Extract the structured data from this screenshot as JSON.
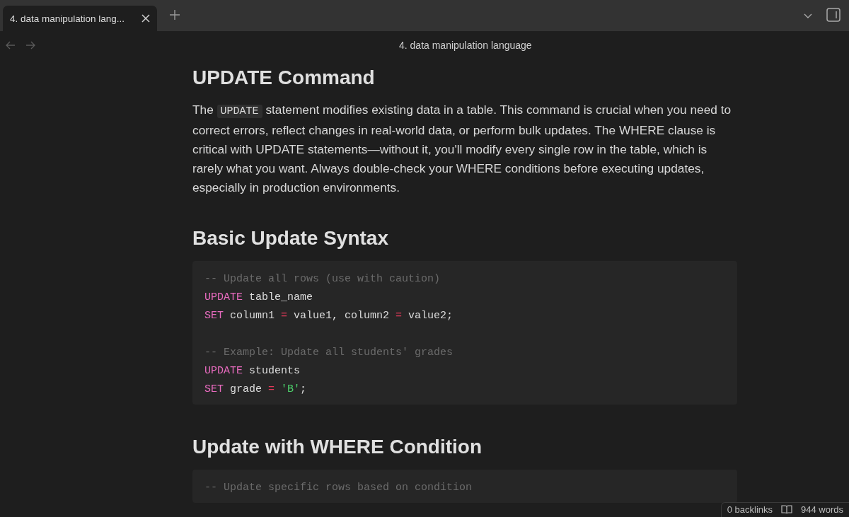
{
  "tabs": [
    {
      "label": "4. data manipulation lang...",
      "selected": true
    }
  ],
  "note_title": "4. data manipulation language",
  "sections": [
    {
      "heading": "UPDATE Command",
      "paragraph": {
        "before": "The ",
        "code": "UPDATE",
        "after": " statement modifies existing data in a table. This command is crucial when you need to correct errors, reflect changes in real-world data, or perform bulk updates. The WHERE clause is critical with UPDATE statements—without it, you'll modify every single row in the table, which is rarely what you want. Always double-check your WHERE conditions before executing updates, especially in production environments."
      }
    },
    {
      "heading": "Basic Update Syntax",
      "code_lines": [
        {
          "kind": "code",
          "tokens": [
            {
              "kind": "comment",
              "text": "-- Update all rows (use with caution)"
            }
          ]
        },
        {
          "kind": "code",
          "tokens": [
            {
              "kind": "keyword",
              "text": "UPDATE"
            },
            {
              "kind": "plain",
              "text": " table_name"
            }
          ]
        },
        {
          "kind": "code",
          "tokens": [
            {
              "kind": "keyword",
              "text": "SET"
            },
            {
              "kind": "plain",
              "text": " column1 "
            },
            {
              "kind": "operator",
              "text": "="
            },
            {
              "kind": "plain",
              "text": " value1, column2 "
            },
            {
              "kind": "operator",
              "text": "="
            },
            {
              "kind": "plain",
              "text": " value2;"
            }
          ]
        },
        {
          "kind": "blank"
        },
        {
          "kind": "code",
          "tokens": [
            {
              "kind": "comment",
              "text": "-- Example: Update all students' grades"
            }
          ]
        },
        {
          "kind": "code",
          "tokens": [
            {
              "kind": "keyword",
              "text": "UPDATE"
            },
            {
              "kind": "plain",
              "text": " students"
            }
          ]
        },
        {
          "kind": "code",
          "tokens": [
            {
              "kind": "keyword",
              "text": "SET"
            },
            {
              "kind": "plain",
              "text": " grade "
            },
            {
              "kind": "operator",
              "text": "= "
            },
            {
              "kind": "string",
              "text": "'B'"
            },
            {
              "kind": "plain",
              "text": ";"
            }
          ]
        }
      ]
    },
    {
      "heading": "Update with WHERE Condition",
      "code_lines": [
        {
          "kind": "code",
          "tokens": [
            {
              "kind": "comment",
              "text": "-- Update specific rows based on condition"
            }
          ]
        }
      ]
    }
  ],
  "status_bar": {
    "backlinks": "0 backlinks",
    "words": "944 words"
  }
}
